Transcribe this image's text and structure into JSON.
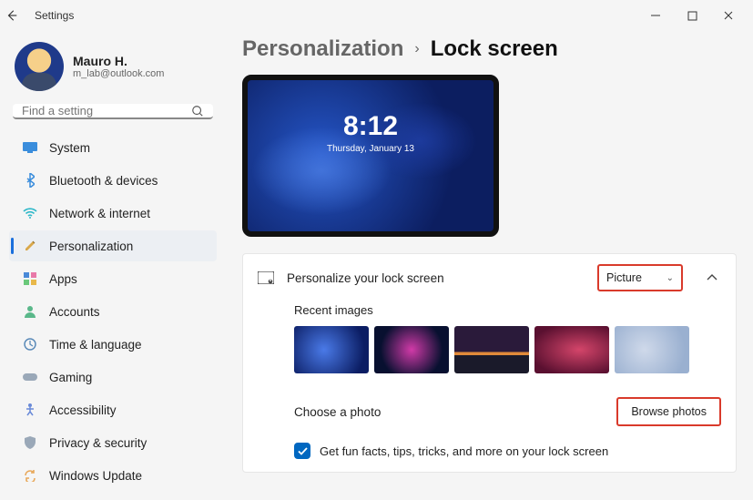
{
  "window": {
    "title": "Settings"
  },
  "user": {
    "name": "Mauro H.",
    "email": "m_lab@outlook.com"
  },
  "search": {
    "placeholder": "Find a setting"
  },
  "nav": {
    "items": [
      {
        "label": "System"
      },
      {
        "label": "Bluetooth & devices"
      },
      {
        "label": "Network & internet"
      },
      {
        "label": "Personalization"
      },
      {
        "label": "Apps"
      },
      {
        "label": "Accounts"
      },
      {
        "label": "Time & language"
      },
      {
        "label": "Gaming"
      },
      {
        "label": "Accessibility"
      },
      {
        "label": "Privacy & security"
      },
      {
        "label": "Windows Update"
      }
    ]
  },
  "breadcrumb": {
    "parent": "Personalization",
    "current": "Lock screen"
  },
  "preview": {
    "time": "8:12",
    "date": "Thursday, January 13"
  },
  "panel": {
    "personalize_label": "Personalize your lock screen",
    "dropdown_value": "Picture",
    "recent_label": "Recent images",
    "choose_label": "Choose a photo",
    "browse_label": "Browse photos",
    "funfacts_label": "Get fun facts, tips, tricks, and more on your lock screen"
  }
}
